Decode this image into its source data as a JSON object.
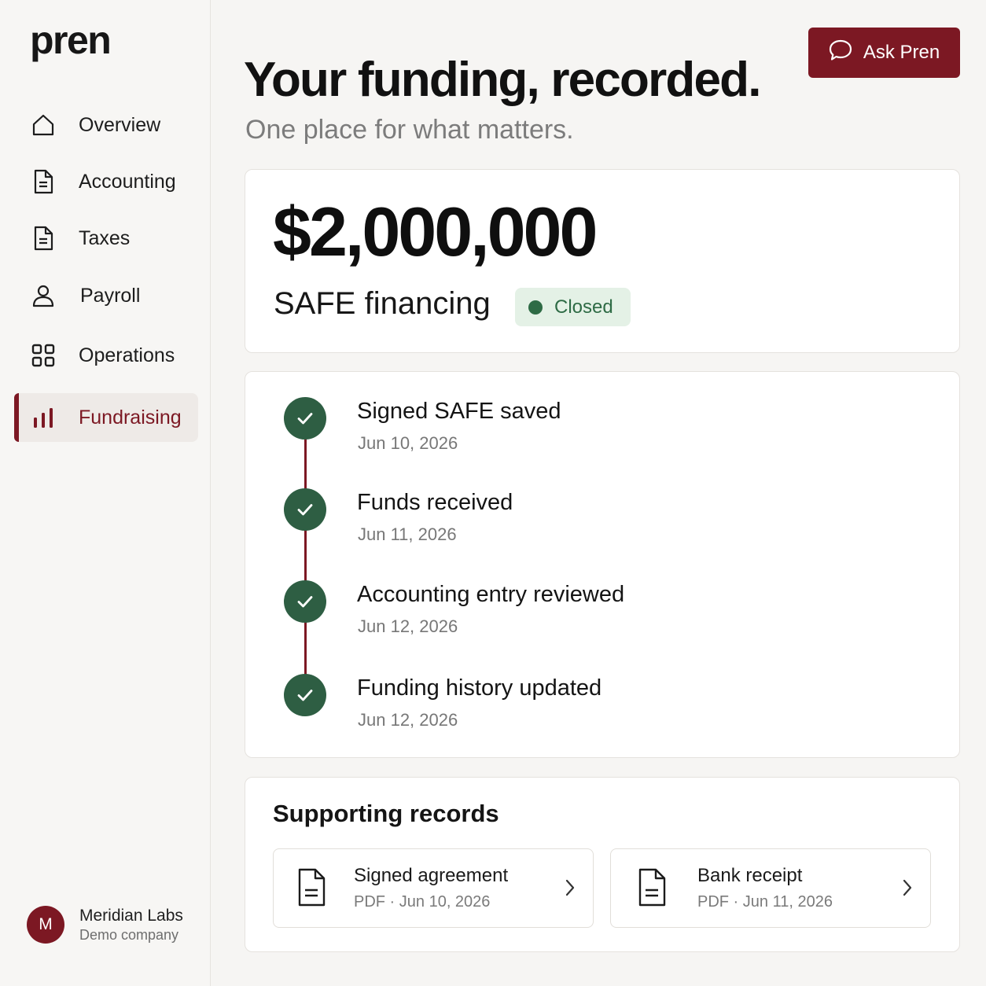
{
  "app": {
    "logo": "pren"
  },
  "sidebar": {
    "items": [
      {
        "label": "Overview",
        "icon": "home-icon",
        "active": false
      },
      {
        "label": "Accounting",
        "icon": "document-icon",
        "active": false
      },
      {
        "label": "Taxes",
        "icon": "document-icon",
        "active": false
      },
      {
        "label": "Payroll",
        "icon": "person-icon",
        "active": false
      },
      {
        "label": "Operations",
        "icon": "grid-icon",
        "active": false
      },
      {
        "label": "Fundraising",
        "icon": "bar-chart-icon",
        "active": true
      }
    ],
    "user": {
      "initial": "M",
      "name": "Meridian Labs",
      "subtitle": "Demo company"
    }
  },
  "header": {
    "ask_button": "Ask Pren",
    "title": "Your funding, recorded.",
    "subtitle": "One place for what matters."
  },
  "summary": {
    "amount": "$2,000,000",
    "type": "SAFE financing",
    "status": "Closed"
  },
  "timeline": [
    {
      "title": "Signed SAFE saved",
      "date": "Jun 10, 2026",
      "done": true
    },
    {
      "title": "Funds received",
      "date": "Jun 11, 2026",
      "done": true
    },
    {
      "title": "Accounting entry reviewed",
      "date": "Jun 12, 2026",
      "done": true
    },
    {
      "title": "Funding history updated",
      "date": "Jun 12, 2026",
      "done": true
    }
  ],
  "records": {
    "title": "Supporting records",
    "items": [
      {
        "name": "Signed agreement",
        "meta": "PDF · Jun 10, 2026"
      },
      {
        "name": "Bank receipt",
        "meta": "PDF · Jun 11, 2026"
      }
    ]
  },
  "colors": {
    "accent": "#7c1823",
    "success": "#2e6b45",
    "background": "#f6f5f3"
  }
}
